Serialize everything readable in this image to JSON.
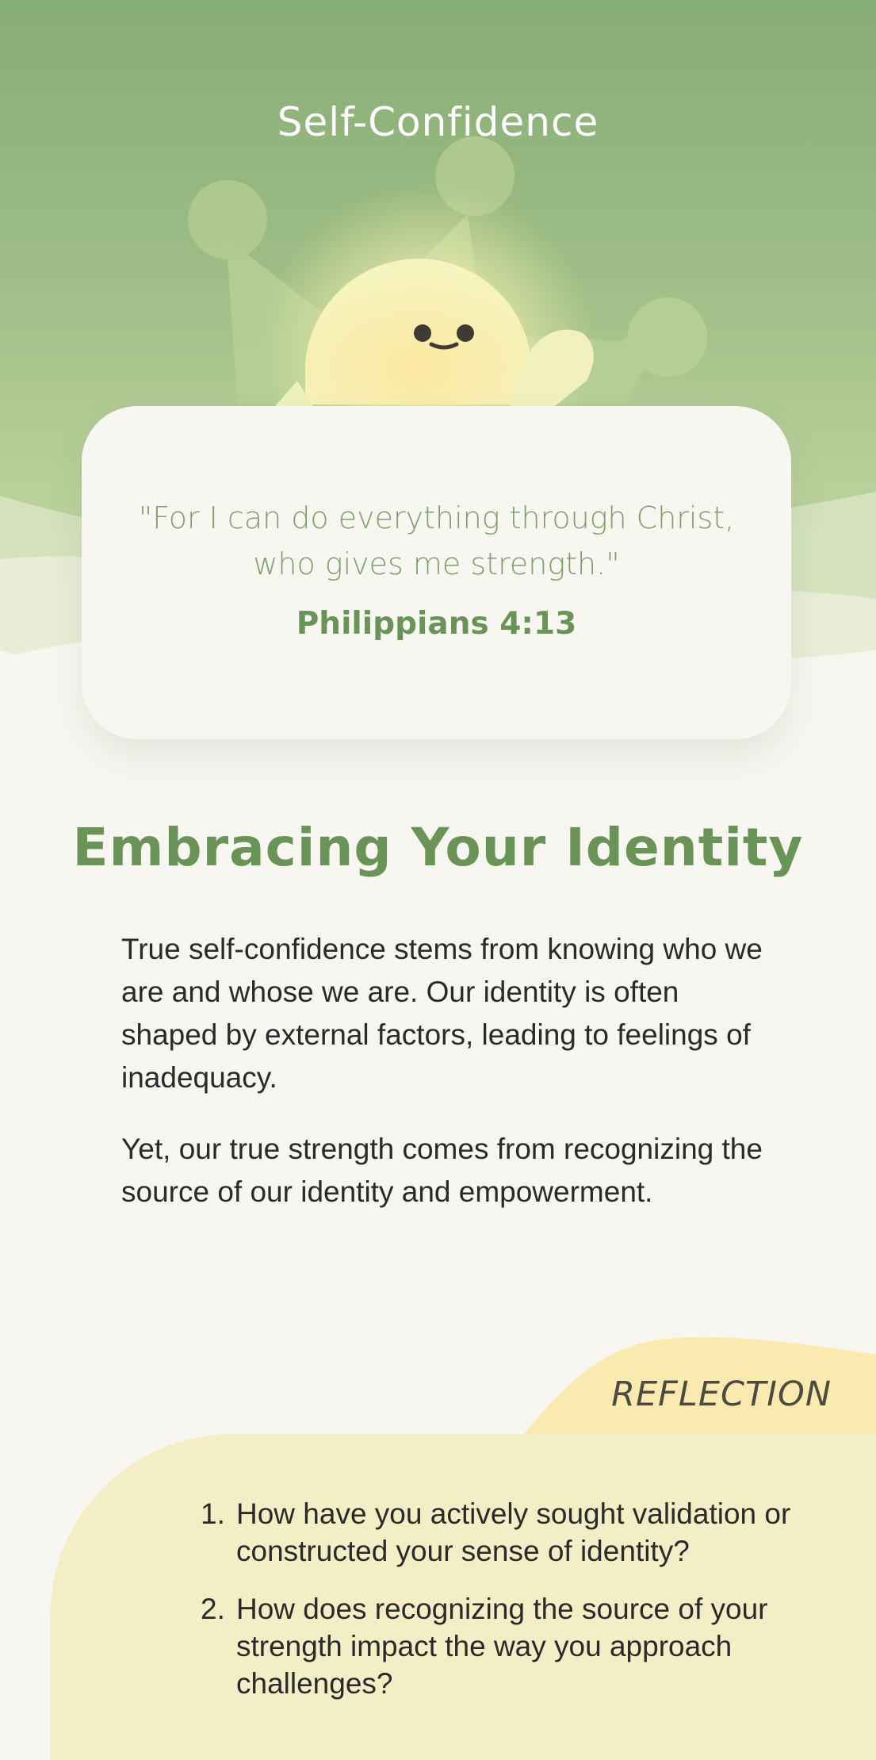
{
  "header": {
    "title": "Self-Confidence"
  },
  "verse": {
    "text": "\"For I can do everything through Christ, who gives me strength.\"",
    "reference": "Philippians 4:13"
  },
  "main": {
    "heading": "Embracing Your Identity",
    "paragraphs": [
      "True self-confidence stems from knowing who we are and whose we are. Our identity is often shaped by external factors, leading to feelings of inadequacy.",
      "Yet, our true strength comes from recognizing the source of our identity and empowerment."
    ]
  },
  "reflection": {
    "label": "REFLECTION",
    "questions": [
      {
        "number": "1.",
        "text": "How have you actively sought validation or constructed your sense of identity?"
      },
      {
        "number": "2.",
        "text": "How does recognizing the source of your strength impact the way you approach challenges?"
      }
    ]
  },
  "colors": {
    "hero_top": "#86ad74",
    "hero_bottom": "#c6d9a7",
    "accent_green": "#6a9358",
    "verse_green": "#7ea06a",
    "background": "#f8f6f1",
    "reflection_bg": "#f3eec6",
    "reflection_tab": "#faeab0",
    "mascot_body": "#fbf5b5"
  },
  "icons": {
    "hero_illustration": "smiling-sun-mascot-with-crown-icon"
  }
}
